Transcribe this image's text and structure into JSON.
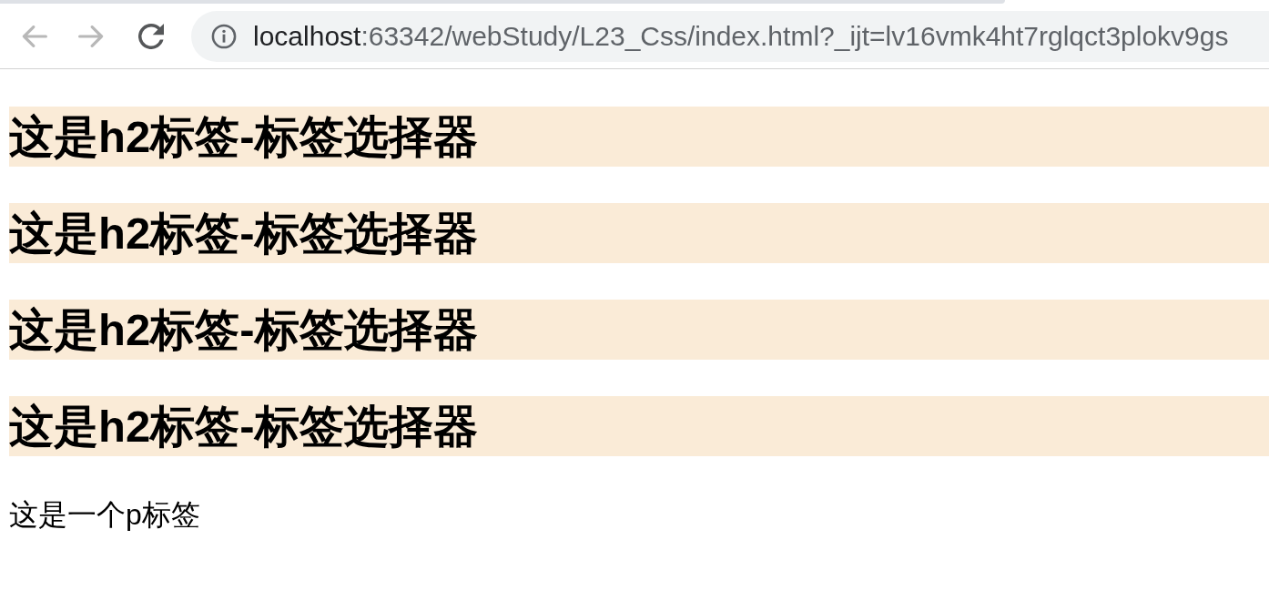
{
  "browser": {
    "nav_buttons": [
      {
        "kind": "back",
        "disabled": true
      },
      {
        "kind": "forward",
        "disabled": true
      },
      {
        "kind": "reload",
        "disabled": false
      }
    ],
    "address_bar": {
      "host": "localhost",
      "path": ":63342/webStudy/L23_Css/index.html?_ijt=lv16vmk4ht7rglqct3plokv9gs"
    }
  },
  "page": {
    "headings": [
      "这是h2标签-标签选择器",
      "这是h2标签-标签选择器",
      "这是h2标签-标签选择器",
      "这是h2标签-标签选择器"
    ],
    "paragraph": "这是一个p标签"
  }
}
